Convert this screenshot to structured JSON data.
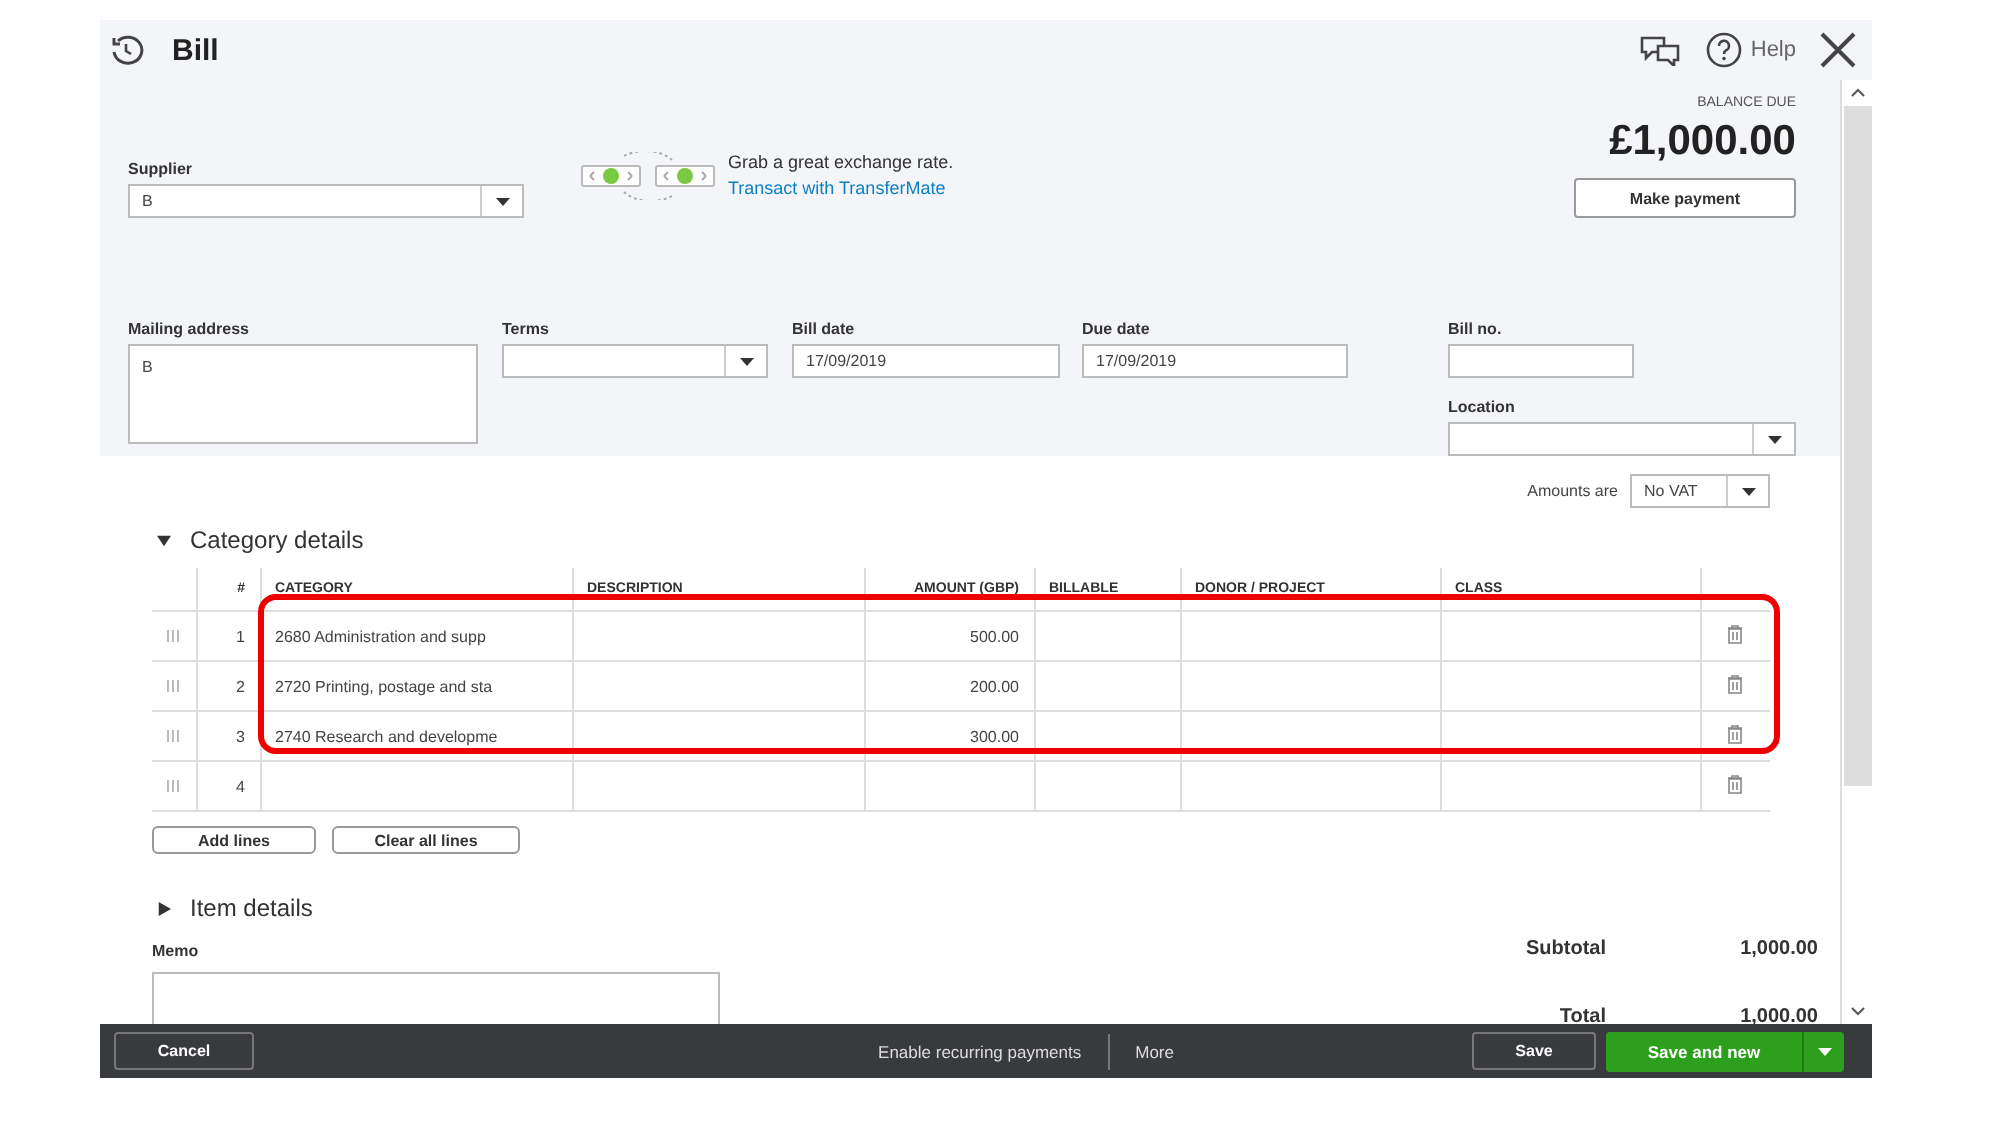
{
  "window": {
    "title": "Bill",
    "help": "Help"
  },
  "supplier": {
    "label": "Supplier",
    "value": "B"
  },
  "promo": {
    "text": "Grab a great exchange rate.",
    "link": "Transact with TransferMate"
  },
  "balance": {
    "label": "BALANCE DUE",
    "amount": "£1,000.00",
    "button": "Make payment"
  },
  "mailing_address": {
    "label": "Mailing address",
    "value": "B"
  },
  "terms": {
    "label": "Terms"
  },
  "bill_date": {
    "label": "Bill date",
    "value": "17/09/2019"
  },
  "due_date": {
    "label": "Due date",
    "value": "17/09/2019"
  },
  "bill_no": {
    "label": "Bill no."
  },
  "location": {
    "label": "Location"
  },
  "amounts_are": {
    "label": "Amounts are",
    "value": "No VAT"
  },
  "category_details": {
    "title": "Category details",
    "expanded": true,
    "columns": [
      "#",
      "CATEGORY",
      "DESCRIPTION",
      "AMOUNT (GBP)",
      "BILLABLE",
      "DONOR / PROJECT",
      "CLASS"
    ],
    "rows": [
      {
        "number": "1",
        "category": "2680 Administration and supp",
        "amount": "500.00",
        "highlighted": true
      },
      {
        "number": "2",
        "category": "2720 Printing, postage and sta",
        "amount": "200.00",
        "highlighted": true
      },
      {
        "number": "3",
        "category": "2740 Research and developme",
        "amount": "300.00",
        "highlighted": true
      },
      {
        "number": "4",
        "highlighted": false
      }
    ],
    "buttons": [
      "Add lines",
      "Clear all lines"
    ]
  },
  "item_details": {
    "title": "Item details",
    "expanded": false
  },
  "memo": {
    "label": "Memo"
  },
  "totals": [
    {
      "label": "Subtotal",
      "value": "1,000.00"
    },
    {
      "label": "Total",
      "value": "1,000.00"
    }
  ],
  "footer": {
    "cancel": "Cancel",
    "recurring": "Enable recurring payments",
    "more": "More",
    "save": "Save",
    "save_new": "Save and new"
  }
}
